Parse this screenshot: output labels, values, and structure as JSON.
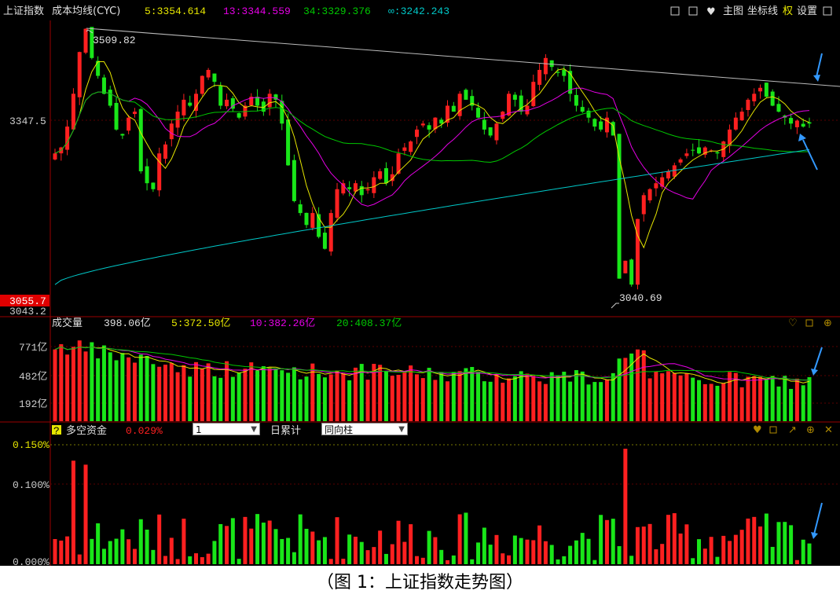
{
  "main": {
    "index_name": "上证指数",
    "indicator_name": "成本均线(CYC)",
    "ma5": "5:3354.614",
    "ma13": "13:3344.559",
    "ma34": "34:3329.376",
    "ma_inf": "∞:3242.243",
    "right_tools": [
      "主图",
      "坐标线",
      "权",
      "设置"
    ],
    "y_label_mid": "3347.5",
    "y_label_low": "3055.7",
    "y_label_min": "3043.2",
    "high_label": "3509.82",
    "low_label": "3040.69"
  },
  "volume": {
    "title": "成交量",
    "value": "398.06亿",
    "ma5": "5:372.50亿",
    "ma10": "10:382.26亿",
    "ma20": "20:408.37亿",
    "ticks": [
      "771亿",
      "482亿",
      "192亿"
    ]
  },
  "capital": {
    "help": "?",
    "title": "多空资金",
    "value": "0.029%",
    "select_value": "1",
    "mode_label": "日累计",
    "select2_value": "同向柱",
    "ticks": [
      "0.150%",
      "0.100%",
      "0.000%"
    ]
  },
  "colors": {
    "up": "#ff2020",
    "down": "#19e619",
    "ma5": "#e6e600",
    "ma13": "#e600e6",
    "ma34": "#00c800",
    "ma_inf": "#00c8c8",
    "arrow": "#3399ff"
  },
  "chart_data": {
    "type": "candlestick",
    "y_range": [
      3040.69,
      3509.82
    ],
    "closes": [
      3300,
      3310,
      3345,
      3400,
      3470,
      3509,
      3460,
      3430,
      3400,
      3380,
      3340,
      3330,
      3360,
      3370,
      3270,
      3250,
      3240,
      3300,
      3315,
      3350,
      3370,
      3390,
      3380,
      3400,
      3430,
      3440,
      3420,
      3380,
      3390,
      3375,
      3360,
      3380,
      3395,
      3380,
      3370,
      3400,
      3390,
      3350,
      3280,
      3220,
      3200,
      3180,
      3200,
      3160,
      3140,
      3200,
      3240,
      3250,
      3240,
      3250,
      3230,
      3240,
      3260,
      3270,
      3250,
      3265,
      3300,
      3310,
      3320,
      3340,
      3350,
      3340,
      3360,
      3350,
      3380,
      3370,
      3400,
      3390,
      3380,
      3360,
      3340,
      3330,
      3350,
      3370,
      3400,
      3390,
      3370,
      3380,
      3420,
      3440,
      3460,
      3445,
      3435,
      3430,
      3400,
      3380,
      3370,
      3360,
      3345,
      3340,
      3360,
      3330,
      3090,
      3120,
      3080,
      3190,
      3230,
      3240,
      3250,
      3260,
      3270,
      3280,
      3290,
      3300,
      3305,
      3300,
      3310,
      3305,
      3300,
      3320,
      3340,
      3360,
      3370,
      3390,
      3400,
      3410,
      3395,
      3380,
      3370,
      3360,
      3350,
      3355,
      3345,
      3350
    ],
    "volume_unit": "亿",
    "capital_unit": "%"
  }
}
